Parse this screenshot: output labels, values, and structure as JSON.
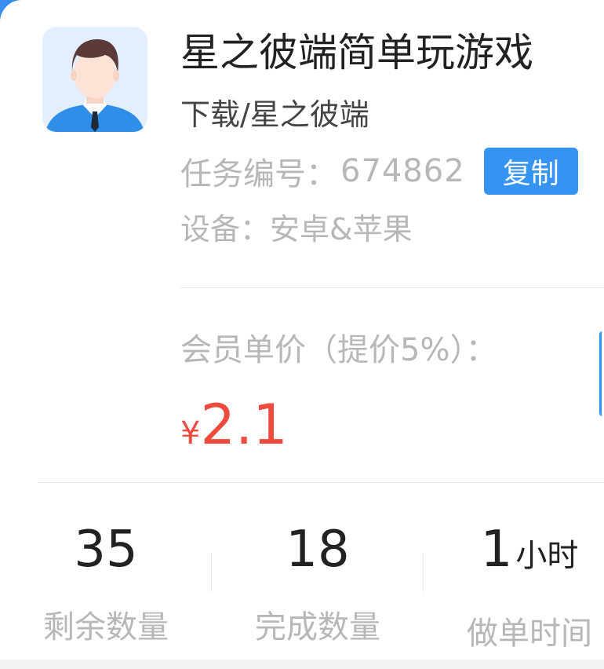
{
  "task": {
    "title": "星之彼端简单玩游戏",
    "subtitle": "下载/星之彼端",
    "id_label": "任务编号：",
    "id_value": "674862",
    "copy_label": "复制",
    "device_label": "设备：",
    "device_value": "安卓&苹果"
  },
  "price": {
    "label": "会员单价（提价5%）：",
    "currency": "¥",
    "value": "2.1"
  },
  "stats": [
    {
      "value": "35",
      "unit": "",
      "label": "剩余数量"
    },
    {
      "value": "18",
      "unit": "",
      "label": "完成数量"
    },
    {
      "value": "1",
      "unit": "小时",
      "label": "做单时间"
    }
  ],
  "colors": {
    "accent": "#3594f2",
    "price": "#ee4b3f",
    "muted_text": "#b7b7b7",
    "avatar_bg": "#e3efff"
  },
  "icons": {
    "avatar": "businessman-avatar-icon"
  }
}
